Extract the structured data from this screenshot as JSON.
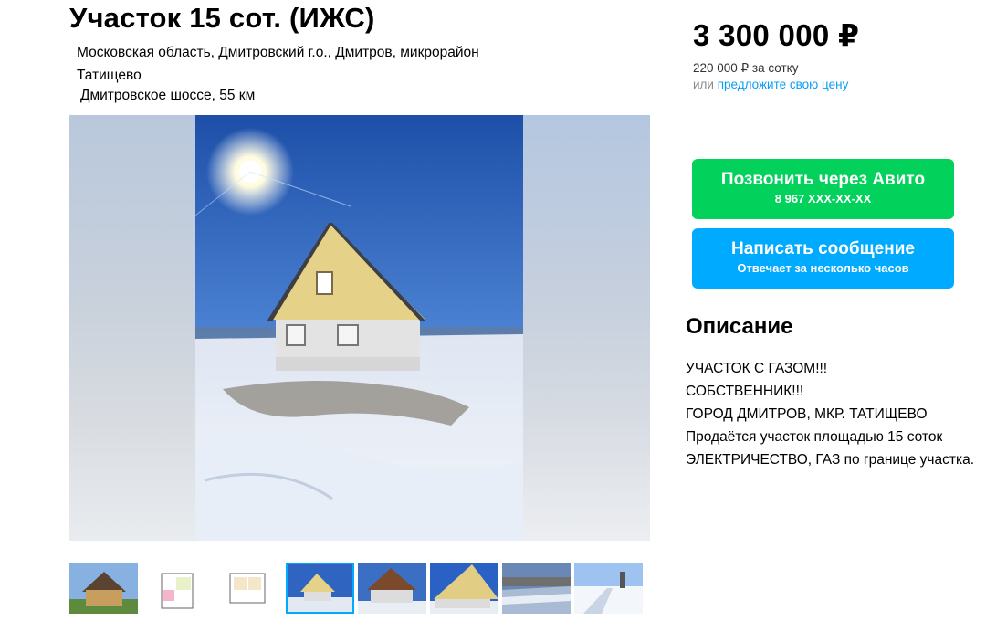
{
  "listing": {
    "title": "Участок 15 сот. (ИЖС)",
    "address_line1": "Московская область, Дмитровский г.о., Дмитров, микрорайон",
    "address_line2": "Татищево",
    "highway": "Дмитровское шоссе, 55 км",
    "price": "3 300 000 ₽",
    "price_per_unit": "220 000 ₽ за сотку",
    "offer_prefix": "или",
    "offer_link": "предложите свою цену"
  },
  "contact": {
    "call_label": "Позвонить через Авито",
    "phone": "8 967 XXX-XX-XX",
    "message_label": "Написать сообщение",
    "reply_time": "Отвечает за несколько часов"
  },
  "description": {
    "heading": "Описание",
    "lines": [
      "УЧАСТОК С ГАЗОМ!!!",
      "СОБСТВЕННИК!!!",
      "ГОРОД ДМИТРОВ, МКР. ТАТИЩЕВО",
      "Продаётся участок площадью 15 соток",
      "ЭЛЕКТРИЧЕСТВО, ГАЗ по границе участка."
    ]
  },
  "gallery": {
    "active_index": 3,
    "thumbnails": [
      "house-summer",
      "floor-plan-1",
      "floor-plan-2",
      "house-winter-sun",
      "house-winter-front",
      "house-winter-side",
      "field-river",
      "snowy-road"
    ]
  },
  "colors": {
    "call_button": "#02d15c",
    "message_button": "#00aaff",
    "link": "#0a9cf5"
  }
}
